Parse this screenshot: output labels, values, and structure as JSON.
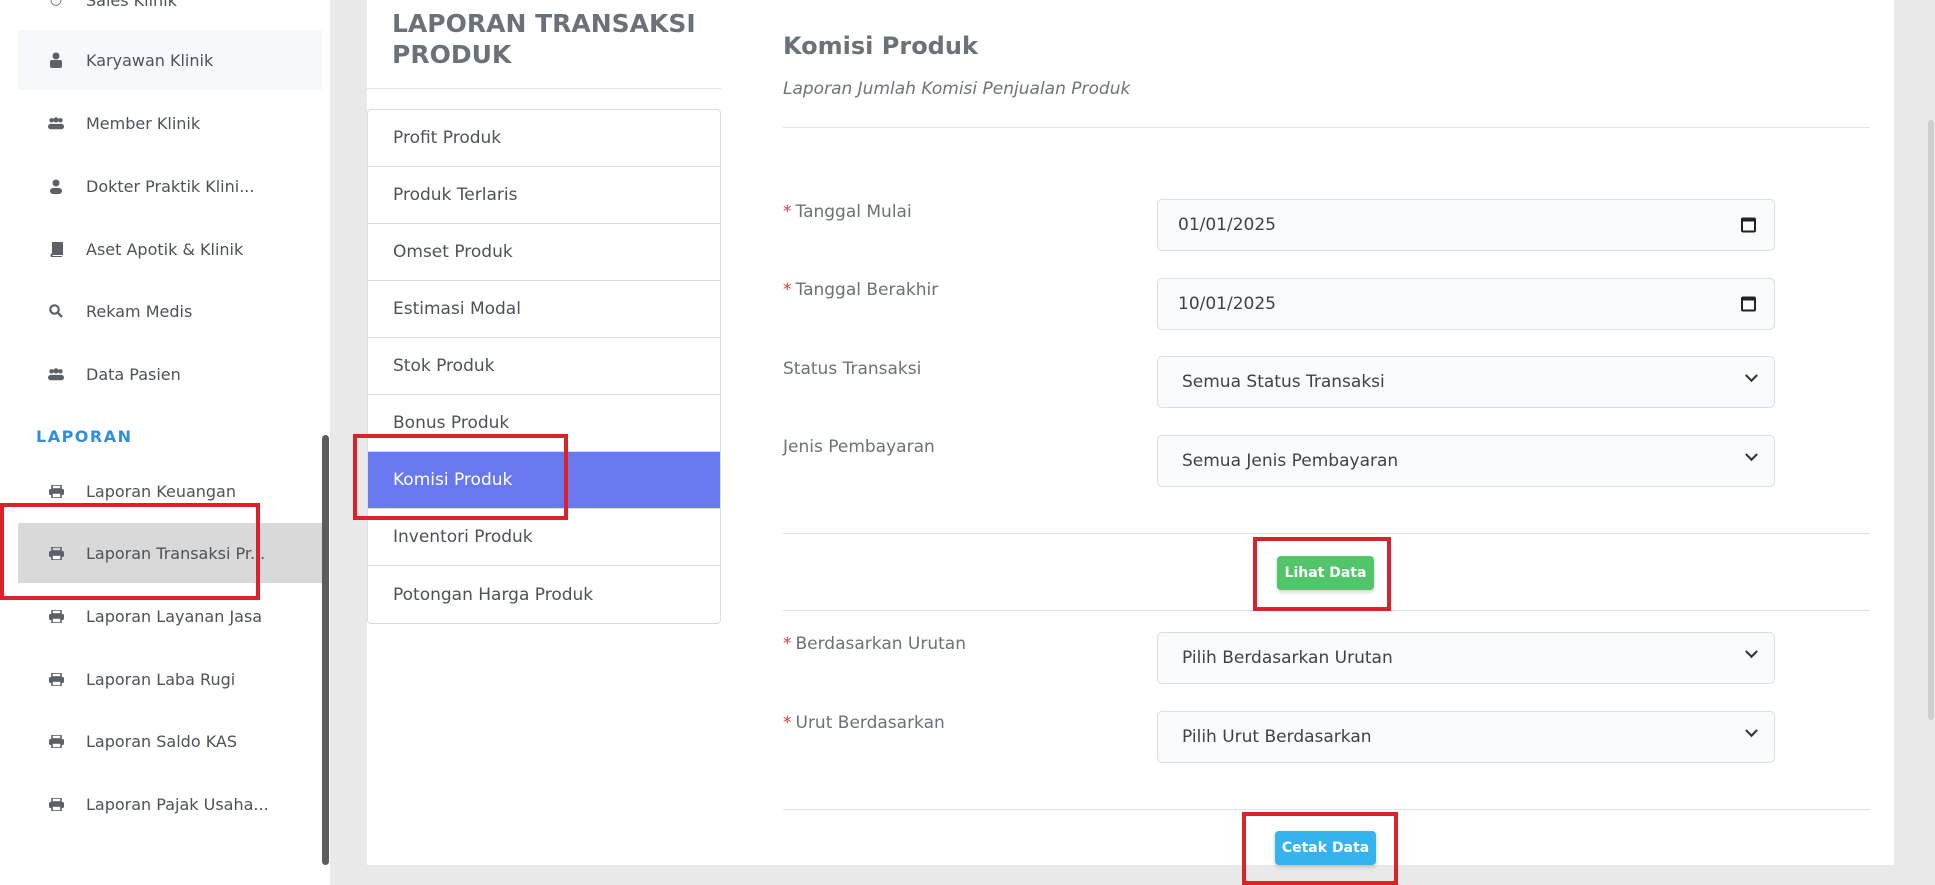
{
  "sidebar": {
    "partial_top_item": "Sales Klinik",
    "items": [
      {
        "label": "Karyawan Klinik",
        "icon": "user-lock-icon"
      },
      {
        "label": "Member Klinik",
        "icon": "users-icon"
      },
      {
        "label": "Dokter Praktik Klini...",
        "icon": "user-icon"
      },
      {
        "label": "Aset Apotik & Klinik",
        "icon": "book-icon"
      },
      {
        "label": "Rekam Medis",
        "icon": "search-icon"
      },
      {
        "label": "Data Pasien",
        "icon": "users-icon"
      }
    ],
    "section_title": "LAPORAN",
    "report_items": [
      {
        "label": "Laporan Keuangan",
        "icon": "print-icon"
      },
      {
        "label": "Laporan Transaksi Pr...",
        "icon": "print-icon"
      },
      {
        "label": "Laporan Layanan Jasa",
        "icon": "print-icon"
      },
      {
        "label": "Laporan Laba Rugi",
        "icon": "print-icon"
      },
      {
        "label": "Laporan Saldo KAS",
        "icon": "print-icon"
      },
      {
        "label": "Laporan Pajak Usaha...",
        "icon": "print-icon"
      }
    ]
  },
  "report_menu": {
    "title": "LAPORAN TRANSAKSI PRODUK",
    "items": [
      "Profit Produk",
      "Produk Terlaris",
      "Omset Produk",
      "Estimasi Modal",
      "Stok Produk",
      "Bonus Produk",
      "Komisi Produk",
      "Inventori Produk",
      "Potongan Harga Produk"
    ],
    "active_item": "Komisi Produk"
  },
  "main": {
    "title": "Komisi Produk",
    "subtitle": "Laporan Jumlah Komisi Penjualan Produk",
    "required_mark": "*",
    "fields": {
      "start_date": {
        "label": "Tanggal Mulai",
        "value": "01/01/2025"
      },
      "end_date": {
        "label": "Tanggal Berakhir",
        "value": "10/01/2025"
      },
      "status": {
        "label": "Status Transaksi",
        "value": "Semua Status Transaksi"
      },
      "payment": {
        "label": "Jenis Pembayaran",
        "value": "Semua Jenis Pembayaran"
      },
      "order_by": {
        "label": "Berdasarkan Urutan",
        "value": "Pilih Berdasarkan Urutan"
      },
      "sort_by": {
        "label": "Urut Berdasarkan",
        "value": "Pilih Urut Berdasarkan"
      }
    },
    "view_button": "Lihat Data",
    "print_button": "Cetak Data"
  },
  "colors": {
    "active_menu": "#6878ee",
    "view_button": "#52c46a",
    "print_button": "#34b3ee",
    "section_title": "#2f8ee0",
    "annotation": "#d8232a"
  }
}
